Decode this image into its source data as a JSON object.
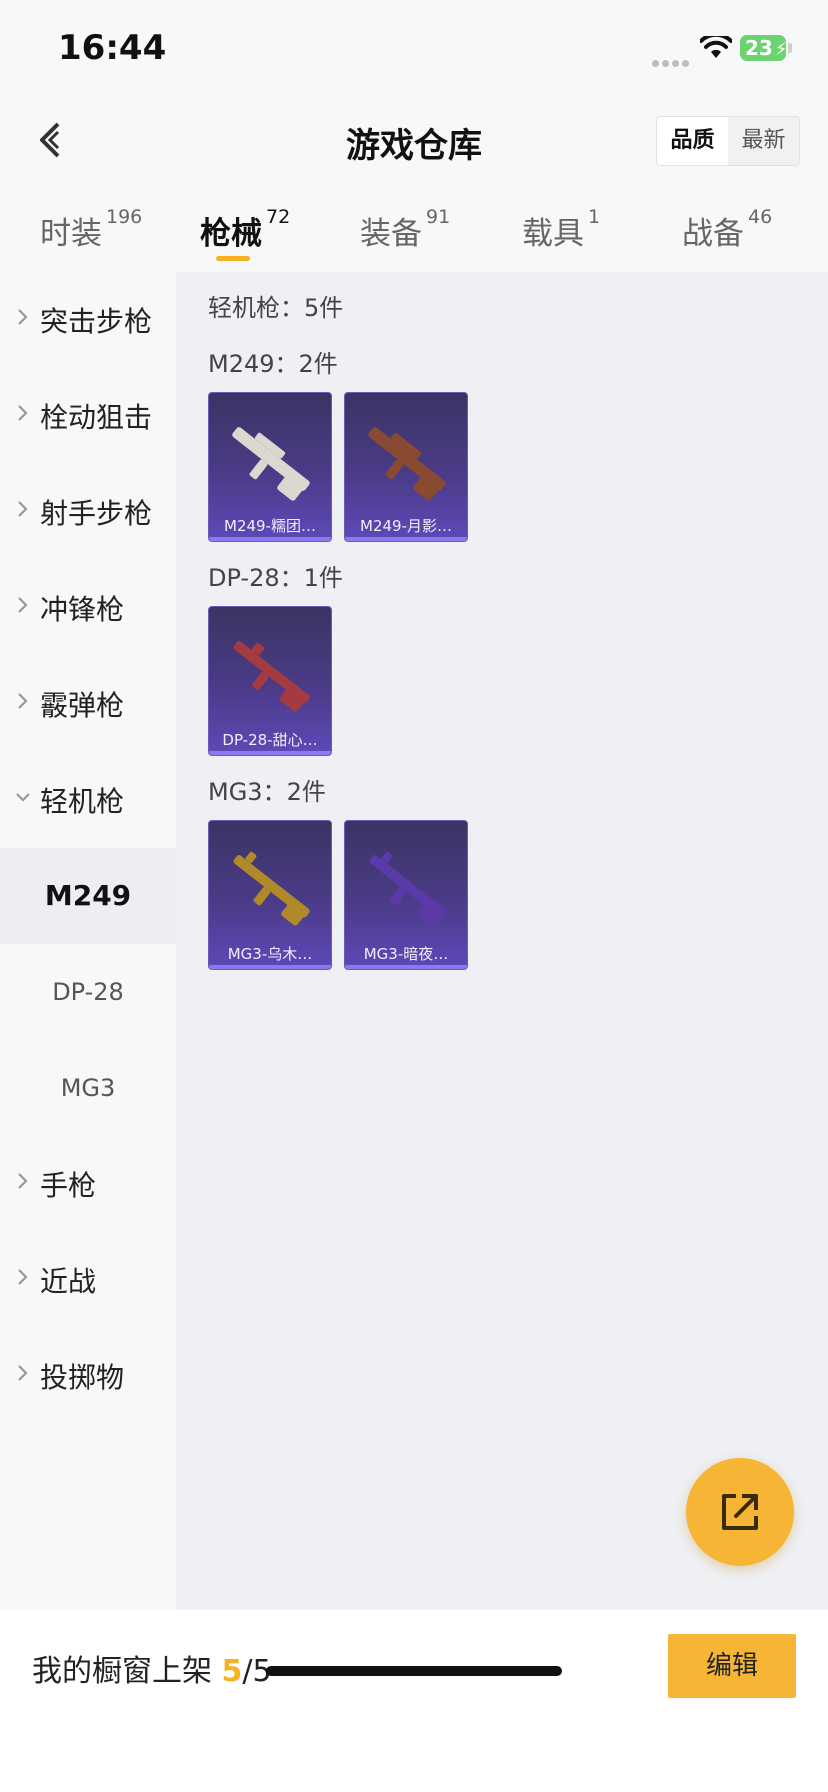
{
  "status_bar": {
    "time": "16:44",
    "battery": "23"
  },
  "header": {
    "title": "游戏仓库",
    "sort_options": [
      "品质",
      "最新"
    ]
  },
  "tabs": [
    {
      "label": "时装",
      "count": "196"
    },
    {
      "label": "枪械",
      "count": "72"
    },
    {
      "label": "装备",
      "count": "91"
    },
    {
      "label": "载具",
      "count": "1"
    },
    {
      "label": "战备",
      "count": "46"
    }
  ],
  "sidebar": {
    "items": [
      {
        "label": "突击步枪"
      },
      {
        "label": "栓动狙击"
      },
      {
        "label": "射手步枪"
      },
      {
        "label": "冲锋枪"
      },
      {
        "label": "霰弹枪"
      },
      {
        "label": "轻机枪"
      }
    ],
    "subitems": [
      {
        "label": "M249"
      },
      {
        "label": "DP-28"
      },
      {
        "label": "MG3"
      }
    ],
    "items_after": [
      {
        "label": "手枪"
      },
      {
        "label": "近战"
      },
      {
        "label": "投掷物"
      }
    ]
  },
  "main": {
    "category_header": "轻机枪：5件",
    "groups": [
      {
        "header": "M249：2件",
        "items": [
          {
            "name": "M249-糯团…",
            "color": "#dcd8cf"
          },
          {
            "name": "M249-月影…",
            "color": "#8a4a32"
          }
        ]
      },
      {
        "header": "DP-28：1件",
        "items": [
          {
            "name": "DP-28-甜心…",
            "color": "#a33b40"
          }
        ]
      },
      {
        "header": "MG3：2件",
        "items": [
          {
            "name": "MG3-乌木…",
            "color": "#b08a2a"
          },
          {
            "name": "MG3-暗夜…",
            "color": "#5a3aa8"
          }
        ]
      }
    ]
  },
  "bottom": {
    "shelf_label": "我的橱窗上架",
    "shelf_current": "5",
    "shelf_total": "/5",
    "edit_label": "编辑"
  },
  "colors": {
    "accent": "#f7b535",
    "card_bg": "#4b3b88"
  },
  "icons": [
    "back-arrow-icon",
    "wifi-icon",
    "battery-icon",
    "chevron-right-icon",
    "chevron-down-icon",
    "share-export-icon",
    "gun-icon"
  ]
}
